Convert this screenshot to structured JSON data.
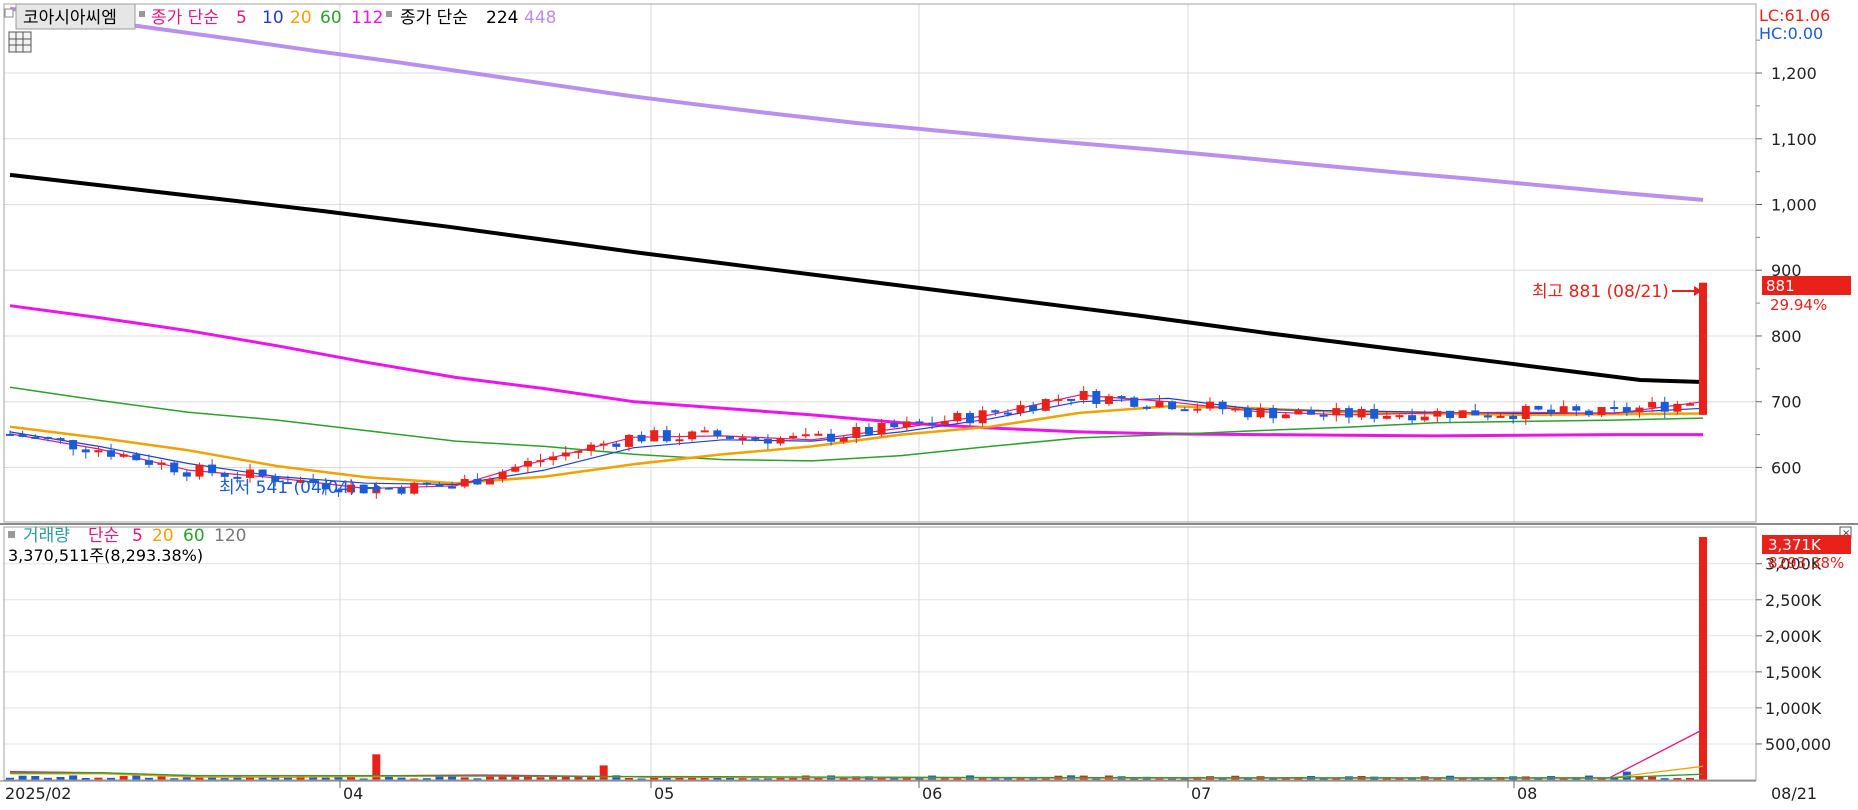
{
  "legend_price": {
    "stock_name": "코아시아씨엠",
    "ma_label": "종가 단순",
    "ma_periods": [
      "5",
      "10",
      "20",
      "60",
      "112"
    ],
    "ma_long_label": "종가 단순",
    "ma_long_periods": [
      "224",
      "448"
    ]
  },
  "legend_volume": {
    "title": "거래량",
    "ma_label": "단순",
    "ma_periods": [
      "5",
      "20",
      "60",
      "120"
    ],
    "volume_text": "3,370,511주(8,293.38%)"
  },
  "right_info": {
    "lc": "LC:61.06",
    "hc": "HC:0.00"
  },
  "price_badge": {
    "value": "881",
    "pct": "29.94%"
  },
  "volume_badge": {
    "value": "3,371K",
    "pct": "8293.38%"
  },
  "annotations": {
    "high": "최고 881 (08/21)",
    "low": "최저 541 (04/04)"
  },
  "x_axis": {
    "labels": [
      "2025/02",
      "04",
      "05",
      "06",
      "07",
      "08"
    ],
    "current": "08/21"
  },
  "colors": {
    "up": "#e8211b",
    "down": "#1a5bd6",
    "ma5": "#e6187e",
    "ma10": "#1f3fd0",
    "ma20": "#f2a100",
    "ma60": "#2ca02c",
    "ma112": "#ee12ee",
    "ma224": "#000000",
    "ma448": "#b990ee"
  },
  "chart_data": [
    {
      "type": "candlestick",
      "title": "코아시아씨엠",
      "y_ticks": [
        600,
        700,
        800,
        900,
        1000,
        1100,
        1200
      ],
      "ylim": [
        517,
        1305
      ],
      "high": {
        "value": 881,
        "date": "08/21"
      },
      "low": {
        "value": 541,
        "date": "04/04"
      },
      "last_close": 881,
      "last_change_pct": 29.94,
      "series": [
        {
          "name": "종가 단순 224",
          "values": [
            1045,
            1034,
            1023,
            1012,
            1001,
            990,
            978,
            966,
            953,
            940,
            927,
            915,
            903,
            891,
            879,
            867,
            855,
            843,
            831,
            818,
            805,
            793,
            781,
            769,
            757,
            745,
            733,
            730
          ]
        },
        {
          "name": "종가 단순 448",
          "values": [
            1298,
            1282,
            1266,
            1250,
            1233,
            1217,
            1200,
            1183,
            1166,
            1151,
            1137,
            1124,
            1113,
            1102,
            1092,
            1082,
            1071,
            1060,
            1049,
            1039,
            1028,
            1017,
            1007
          ]
        }
      ]
    },
    {
      "type": "bar",
      "title": "거래량",
      "y_ticks": [
        "500,000",
        "1,000K",
        "1,500K",
        "2,000K",
        "2,500K",
        "3,000K"
      ],
      "ylim": [
        0,
        3370511
      ],
      "last_volume": 3370511,
      "last_volume_pct": 8293.38
    }
  ]
}
